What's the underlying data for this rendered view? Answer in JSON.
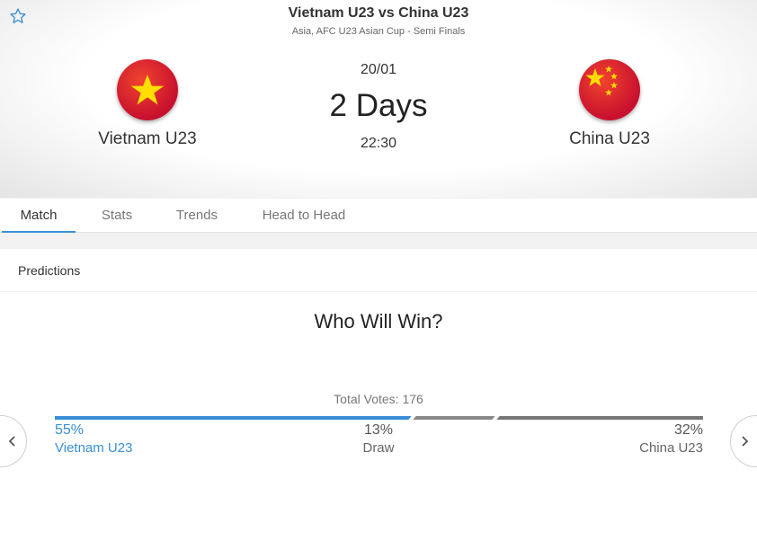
{
  "match": {
    "title": "Vietnam U23 vs China U23",
    "competition": "Asia, AFC U23 Asian Cup - Semi Finals",
    "date": "20/01",
    "countdown": "2 Days",
    "time": "22:30"
  },
  "home_team": {
    "name": "Vietnam U23",
    "flag_icon": "vietnam-flag-icon"
  },
  "away_team": {
    "name": "China U23",
    "flag_icon": "china-flag-icon"
  },
  "tabs": [
    {
      "label": "Match",
      "active": true
    },
    {
      "label": "Stats",
      "active": false
    },
    {
      "label": "Trends",
      "active": false
    },
    {
      "label": "Head to Head",
      "active": false
    }
  ],
  "predictions": {
    "header": "Predictions",
    "poll_title": "Who Will Win?",
    "total_votes": "Total Votes: 176",
    "options": [
      {
        "pct": "55%",
        "label": "Vietnam U23",
        "share": 0.55
      },
      {
        "pct": "13%",
        "label": "Draw",
        "share": 0.13
      },
      {
        "pct": "32%",
        "label": "China U23",
        "share": 0.32
      }
    ]
  },
  "icons": {
    "favorite": "star-outline-icon",
    "prev": "chevron-left-icon",
    "next": "chevron-right-icon"
  },
  "colors": {
    "accent": "#3a8fd6",
    "flag_red": "#c8102e",
    "flag_yellow": "#ffde00"
  }
}
